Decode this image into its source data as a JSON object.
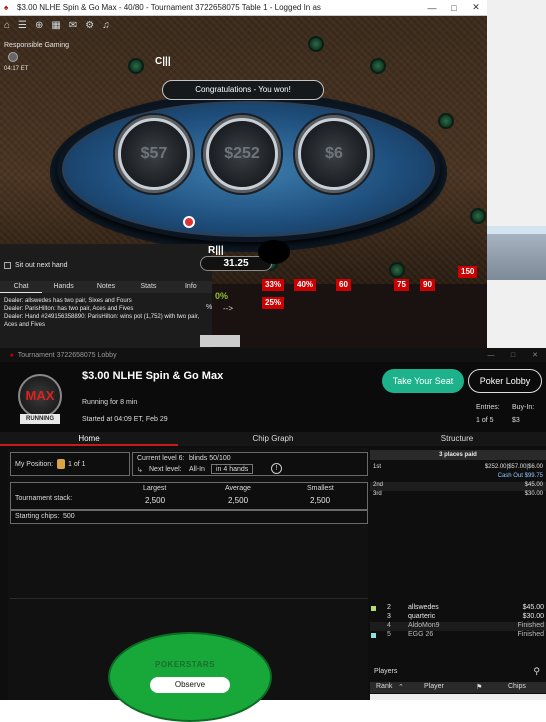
{
  "table_window": {
    "title": "$3.00 NLHE Spin & Go Max - 40/80 - Tournament 3722658075 Table 1 - Logged In as",
    "responsible_gaming": "Responsible Gaming",
    "clock": "04:17 ET",
    "congrats": "Congratulations - You won!",
    "prizes": [
      "$57",
      "$252",
      "$6"
    ],
    "seat_top_name": "C|||",
    "seat_bottom_name": "R|||",
    "seat_bottom_stack": "31.25",
    "sit_out_label": "Sit out next hand",
    "chat_tabs": [
      "Chat",
      "Hands",
      "Notes",
      "Stats",
      "Info"
    ],
    "chat_log": [
      "Dealer: allswedes has two pair, Sixes and Fours",
      "Dealer: ParisHilton: has two pair, Aces and Fives",
      "Dealer: Hand #249156358890: ParisHilton: wins pot (1,752) with two pair, Aces and Fives"
    ],
    "hud_green": "0%",
    "hud_pct": "%",
    "hud_arrow": "-->",
    "hud_boxes": [
      "33%",
      "40%",
      "60",
      "75",
      "90",
      "150",
      "25%"
    ]
  },
  "lobby": {
    "window_title": "Tournament 3722658075 Lobby",
    "logo": "MAX",
    "status_badge": "RUNNING",
    "name": "$3.00 NLHE Spin & Go Max",
    "running_for": "Running for 8 min",
    "started": "Started at 04:09 ET, Feb 29",
    "take_seat": "Take Your Seat",
    "poker_lobby": "Poker Lobby",
    "entries_label": "Entries:",
    "entries_value": "1 of 5",
    "buyin_label": "Buy-In:",
    "buyin_value": "$3",
    "tabs": [
      "Home",
      "Chip Graph",
      "Structure"
    ],
    "my_position_label": "My Position:",
    "my_position_value": "1 of 1",
    "current_level": "Current level 6:",
    "blinds": "blinds 50/100",
    "next_level_label": "Next level:",
    "next_level_value": "All-In",
    "next_level_time": "in 4 hands",
    "stack_label": "Tournament stack:",
    "stack_cols": [
      "Largest",
      "Average",
      "Smallest"
    ],
    "stack_vals": [
      "2,500",
      "2,500",
      "2,500"
    ],
    "starting_chips_label": "Starting chips:",
    "starting_chips_value": "500",
    "places_header": "3 places paid",
    "places": [
      {
        "place": "1st",
        "prize": "$252.00|$57.00|$6.00"
      },
      {
        "place": "",
        "prize": "Cash Out $99.75"
      },
      {
        "place": "2nd",
        "prize": "$45.00"
      },
      {
        "place": "3rd",
        "prize": "$30.00"
      }
    ],
    "players_label": "Players",
    "players_cols": [
      "Rank",
      "Player",
      "Chips"
    ],
    "players": [
      {
        "rank": "2",
        "name": "allswedes",
        "chips": "$45.00"
      },
      {
        "rank": "3",
        "name": "quarteric",
        "chips": "$30.00"
      },
      {
        "rank": "4",
        "name": "AldoMon9",
        "chips": "Finished"
      },
      {
        "rank": "5",
        "name": "EGG 26",
        "chips": "Finished"
      }
    ],
    "table_logo": "POKERSTARS",
    "observe": "Observe"
  },
  "colors": {
    "accent_green": "#1db28c",
    "tab_red": "#c61b1b",
    "hud_red": "#cc0000",
    "felt_blue": "#2a6496"
  }
}
